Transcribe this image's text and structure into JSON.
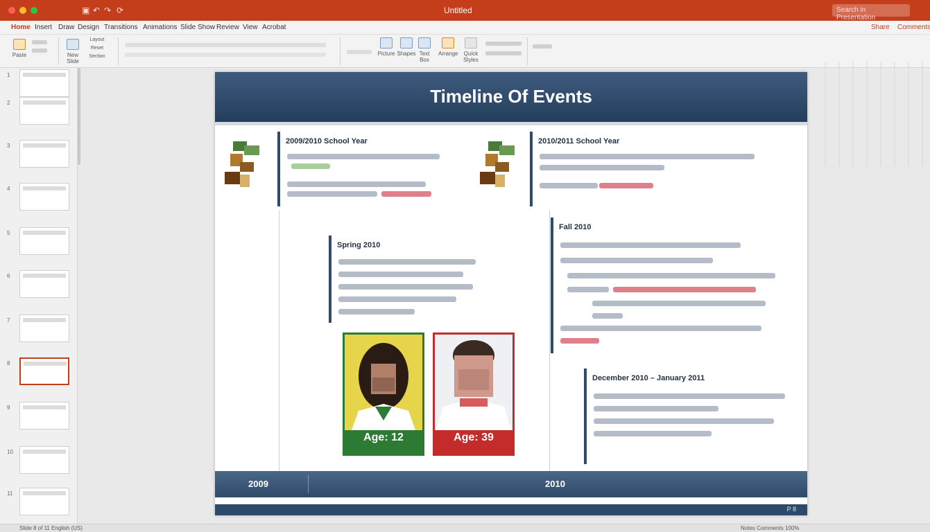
{
  "window": {
    "title": "Untitled",
    "search_placeholder": "Search in Presentation"
  },
  "menu": {
    "tabs": [
      "Home",
      "Insert",
      "Draw",
      "Design",
      "Transitions",
      "Animations",
      "Slide Show",
      "Review",
      "View",
      "Acrobat"
    ],
    "share": "Share",
    "comments": "Comments"
  },
  "ribbon": {
    "paste": "Paste",
    "new_slide": "New Slide",
    "layout": "Layout",
    "reset": "Reset",
    "section": "Section",
    "picture": "Picture",
    "shapes": "Shapes",
    "text_box": "Text Box",
    "arrange": "Arrange",
    "quick_styles": "Quick Styles"
  },
  "slides_panel": {
    "numbers": [
      "1",
      "2",
      "3",
      "4",
      "5",
      "6",
      "7",
      "8",
      "9",
      "10",
      "11"
    ]
  },
  "slide": {
    "title": "Timeline Of Events",
    "card_2009": {
      "title": "2009/2010 School Year"
    },
    "card_2010": {
      "title": "2010/2011 School Year"
    },
    "card_spring": {
      "title": "Spring 2010"
    },
    "card_fall": {
      "title": "Fall 2010"
    },
    "card_dec": {
      "title": "December 2010 – January 2011"
    },
    "photo_left": {
      "age": "Age: 12"
    },
    "photo_right": {
      "age": "Age: 39"
    },
    "footer": {
      "year_left": "2009",
      "year_right": "2010"
    },
    "page_indicator": "P 8"
  },
  "status": {
    "left": "Slide 8 of 11   English (US)",
    "right": "Notes   Comments   100%"
  },
  "colors": {
    "accent": "#c43e1c",
    "slide_blue": "#2f4a6c",
    "green": "#2c7a34",
    "red": "#c42b2b"
  }
}
